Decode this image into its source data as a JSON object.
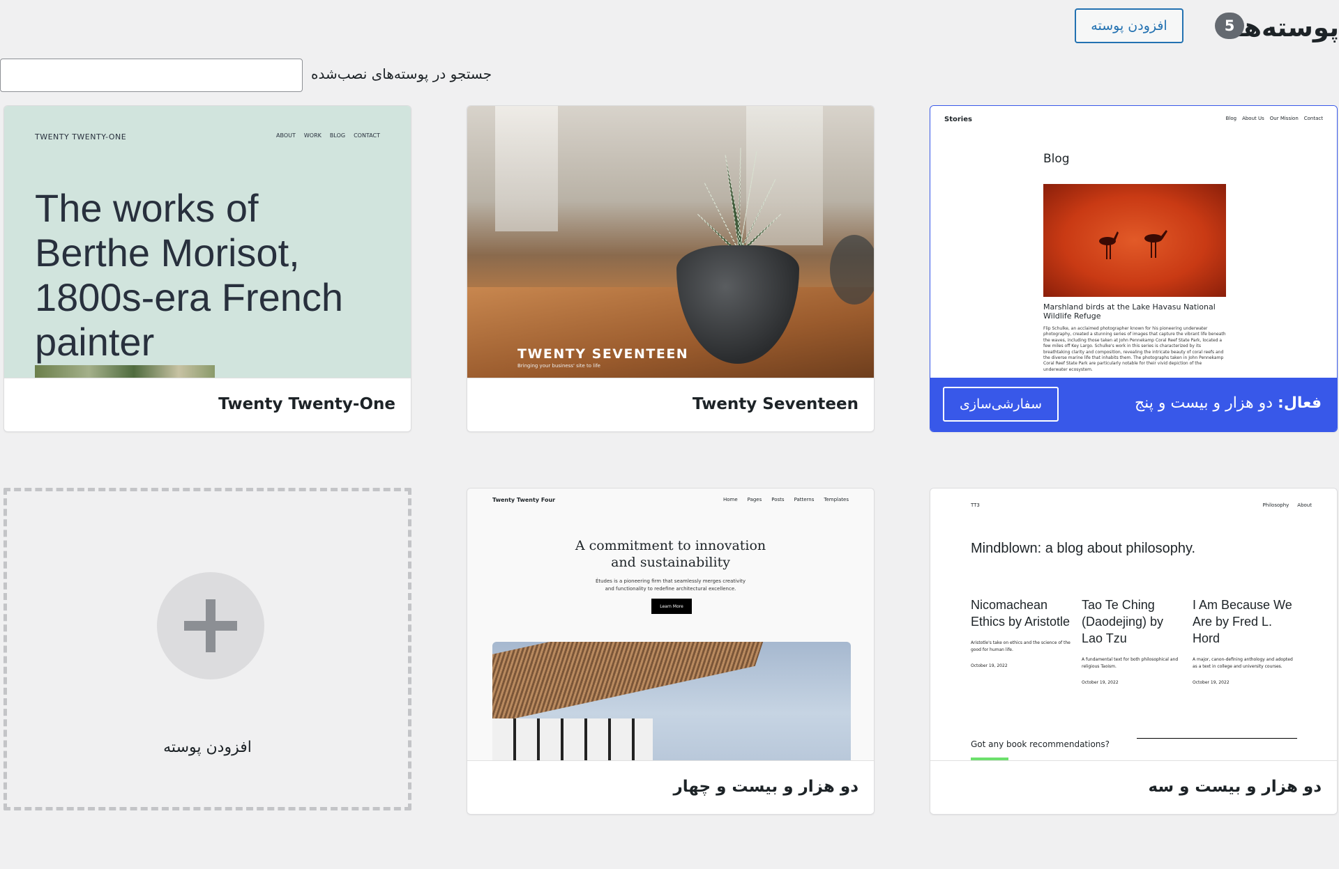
{
  "header": {
    "title": "پوسته‌ها",
    "count": "5",
    "add_button": "افزودن پوسته"
  },
  "search": {
    "label": "جستجو در پوسته‌های نصب‌شده",
    "value": "",
    "placeholder": ""
  },
  "colors": {
    "accent": "#3858e9",
    "button": "#2271b1",
    "background": "#f0f0f1"
  },
  "themes": {
    "tt1": {
      "name": "Twenty Twenty-One",
      "preview_brand": "TWENTY TWENTY-ONE",
      "preview_nav": [
        "ABOUT",
        "WORK",
        "BLOG",
        "CONTACT"
      ],
      "preview_heading": "The works of Berthe Morisot, 1800s-era French painter"
    },
    "t17": {
      "name": "Twenty Seventeen",
      "preview_title": "TWENTY SEVENTEEN",
      "preview_tagline": "Bringing your business' site to life"
    },
    "stories": {
      "preview_brand": "Stories",
      "preview_nav": [
        "Blog",
        "About Us",
        "Our Mission",
        "Contact"
      ],
      "preview_heading": "Blog",
      "preview_caption": "Marshland birds at the Lake Havasu National Wildlife Refuge",
      "preview_body": "Flip Schulke, an acclaimed photographer known for his pioneering underwater photography, created a stunning series of images that capture the vibrant life beneath the waves, including those taken at John Pennekamp Coral Reef State Park, located a few miles off Key Largo. Schulke's work in this series is characterized by its breathtaking clarity and composition, revealing the intricate beauty of coral reefs and the diverse marine life that inhabits them. The photographs taken in John Pennekamp Coral Reef State Park are particularly notable for their vivid depiction of the underwater ecosystem.",
      "active_prefix": "فعال:",
      "active_name": "دو هزار و بیست و پنج",
      "customize_button": "سفارشی‌سازی"
    },
    "tt4": {
      "name": "دو هزار و بیست و چهار",
      "preview_brand": "Twenty Twenty Four",
      "preview_nav": [
        "Home",
        "Pages",
        "Posts",
        "Patterns",
        "Templates"
      ],
      "preview_heading_1": "A commitment to innovation",
      "preview_heading_2": "and sustainability",
      "preview_sub_1": "Études is a pioneering firm that seamlessly merges creativity",
      "preview_sub_2": "and functionality to redefine architectural excellence.",
      "preview_button": "Learn More"
    },
    "tt3": {
      "name": "دو هزار و بیست و سه",
      "preview_brand": "TT3",
      "preview_nav": [
        "Philosophy",
        "About"
      ],
      "preview_heading": "Mindblown: a blog about philosophy.",
      "posts": [
        {
          "title": "Nicomachean Ethics by Aristotle",
          "desc": "Aristotle's take on ethics and the science of the good for human life.",
          "date": "October 19, 2022"
        },
        {
          "title": "Tao Te Ching (Daodejing) by Lao Tzu",
          "desc": "A fundamental text for both philosophical and religious Taoism.",
          "date": "October 19, 2022"
        },
        {
          "title": "I Am Because We Are by Fred L. Hord",
          "desc": "A major, canon-defining anthology and adopted as a text in college and university courses.",
          "date": "October 19, 2022"
        }
      ],
      "preview_ask": "Got any book recommendations?"
    }
  },
  "add_new": {
    "label": "افزودن پوسته"
  }
}
